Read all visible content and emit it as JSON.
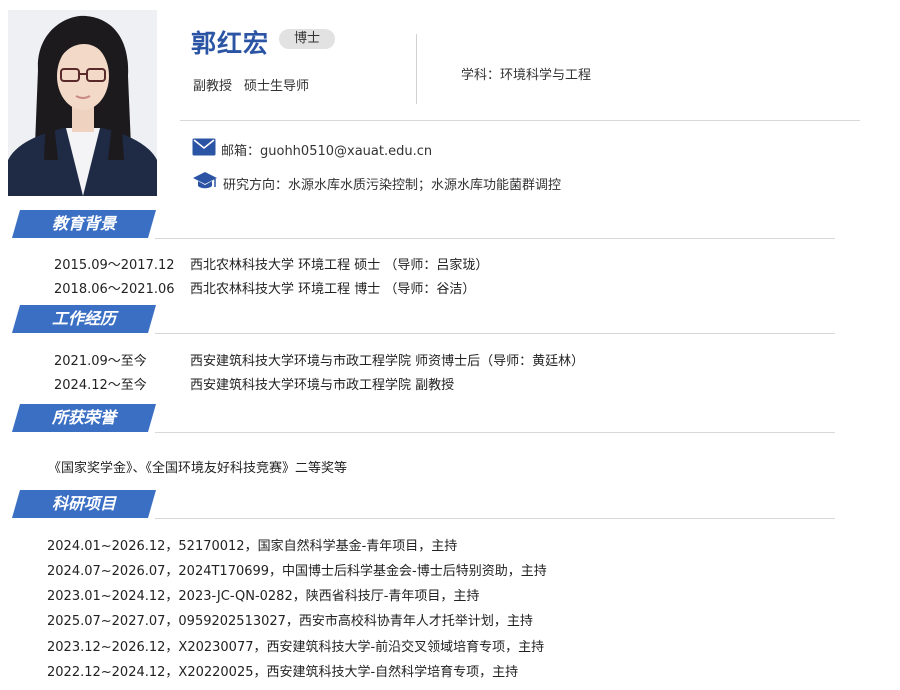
{
  "profile": {
    "name": "郭红宏",
    "degree_badge": "博士",
    "title": "副教授",
    "supervisor": "硕士生导师",
    "subject": "学科：环境科学与工程",
    "email": "邮箱：guohh0510@xauat.edu.cn",
    "research": "研究方向：水源水库水质污染控制；水源水库功能菌群调控"
  },
  "icons": {
    "email": "envelope-icon",
    "research": "graduation-cap-icon"
  },
  "colors": {
    "accent": "#2b55a4",
    "section_bg": "#3a6fc4"
  },
  "education": {
    "heading": "教育背景",
    "items": [
      {
        "date": "2015.09～2017.12",
        "text": "西北农林科技大学 环境工程 硕士 （导师：吕家珑）"
      },
      {
        "date": "2018.06～2021.06",
        "text": "西北农林科技大学 环境工程 博士 （导师：谷洁）"
      }
    ]
  },
  "work": {
    "heading": "工作经历",
    "items": [
      {
        "date": "2021.09～至今",
        "text": "西安建筑科技大学环境与市政工程学院  师资博士后（导师：黄廷林）"
      },
      {
        "date": "2024.12～至今",
        "text": "西安建筑科技大学环境与市政工程学院  副教授"
      }
    ]
  },
  "honors": {
    "heading": "所获荣誉",
    "text": "《国家奖学金》、《全国环境友好科技竞赛》二等奖等"
  },
  "projects": {
    "heading": "科研项目",
    "items": [
      "2024.01~2026.12，52170012，国家自然科学基金-青年项目，主持",
      "2024.07~2026.07，2024T170699，中国博士后科学基金会-博士后特别资助，主持",
      "2023.01~2024.12，2023-JC-QN-0282，陕西省科技厅-青年项目，主持",
      "2025.07~2027.07，0959202513027，西安市高校科协青年人才托举计划，主持",
      "2023.12~2026.12，X20230077，西安建筑科技大学-前沿交叉领域培育专项，主持",
      "2022.12~2024.12，X20220025，西安建筑科技大学-自然科学培育专项，主持"
    ]
  }
}
